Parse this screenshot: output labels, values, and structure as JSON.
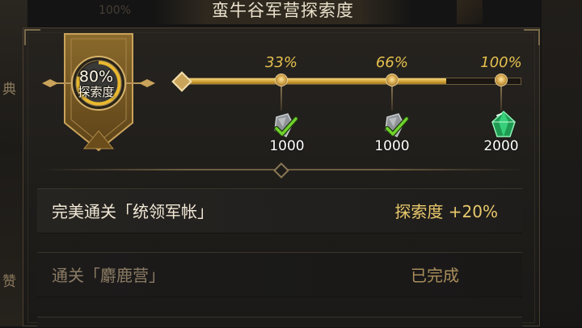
{
  "background": {
    "left_fragments": [
      "典",
      "赞"
    ],
    "top_ghost_text": "100%"
  },
  "title": "蛮牛谷军营探索度",
  "explore_badge": {
    "percent_text": "80%",
    "label": "探索度",
    "progress": 0.8
  },
  "progress_track": {
    "fill": 0.78,
    "milestones": [
      {
        "percent_text": "33%",
        "reward_amount": "1000",
        "reward_icon": "grey-stone-checked-icon",
        "claimed": true
      },
      {
        "percent_text": "66%",
        "reward_amount": "1000",
        "reward_icon": "grey-stone-checked-icon",
        "claimed": true
      },
      {
        "percent_text": "100%",
        "reward_amount": "2000",
        "reward_icon": "green-gem-icon",
        "claimed": false
      }
    ]
  },
  "tasks": [
    {
      "label": "完美通关「统领军帐」",
      "reward": "探索度 +20%",
      "status": "active"
    },
    {
      "label": "通关「麝鹿营」",
      "reward": "已完成",
      "status": "completed"
    }
  ],
  "colors": {
    "accent_gold": "#e6c04e",
    "completed_text": "#a98d5c",
    "check_green": "#6fd12c",
    "gem_green": "#29c06a"
  }
}
